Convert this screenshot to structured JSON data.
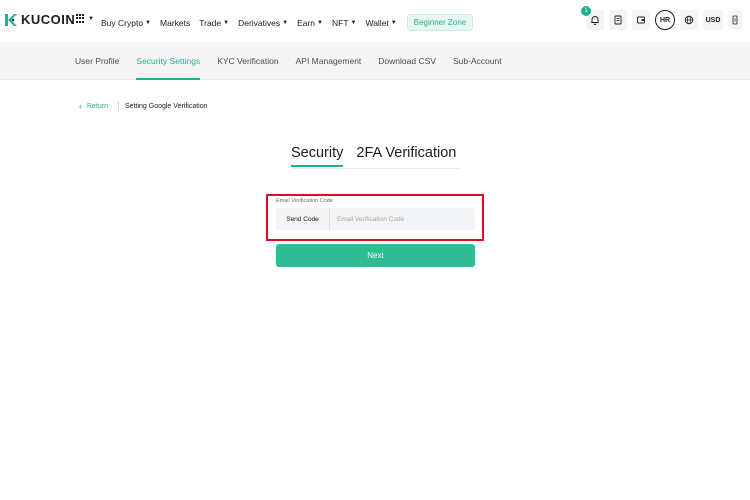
{
  "header": {
    "logo_text": "KUCOIN",
    "nav": [
      {
        "label": "Buy Crypto",
        "has_caret": true
      },
      {
        "label": "Markets",
        "has_caret": false
      },
      {
        "label": "Trade",
        "has_caret": true
      },
      {
        "label": "Derivatives",
        "has_caret": true
      },
      {
        "label": "Earn",
        "has_caret": true
      },
      {
        "label": "NFT",
        "has_caret": true
      },
      {
        "label": "Wallet",
        "has_caret": true
      }
    ],
    "beginner_zone": "Beginner Zone",
    "notification_count": "1",
    "avatar_initials": "HR",
    "currency": "USD"
  },
  "subnav": {
    "tabs": [
      {
        "label": "User Profile",
        "active": false
      },
      {
        "label": "Security Settings",
        "active": true
      },
      {
        "label": "KYC Verification",
        "active": false
      },
      {
        "label": "API Management",
        "active": false
      },
      {
        "label": "Download CSV",
        "active": false
      },
      {
        "label": "Sub-Account",
        "active": false
      }
    ]
  },
  "breadcrumb": {
    "back_label": "Return",
    "current": "Setting Google Verification"
  },
  "title": {
    "part1": "Security",
    "part2": "2FA Verification"
  },
  "form": {
    "field_label": "Email Verification Code",
    "send_code_label": "Send Code",
    "input_placeholder": "Email Verification Code",
    "input_value": "",
    "next_label": "Next"
  },
  "colors": {
    "accent": "#23af91",
    "button": "#2ebd92",
    "highlight_border": "#d7131a"
  },
  "icons": [
    "kucoin-logo-icon",
    "apps-grid-icon",
    "bell-icon",
    "document-icon",
    "wallet-icon",
    "globe-icon",
    "download-icon",
    "back-chevron-icon"
  ]
}
